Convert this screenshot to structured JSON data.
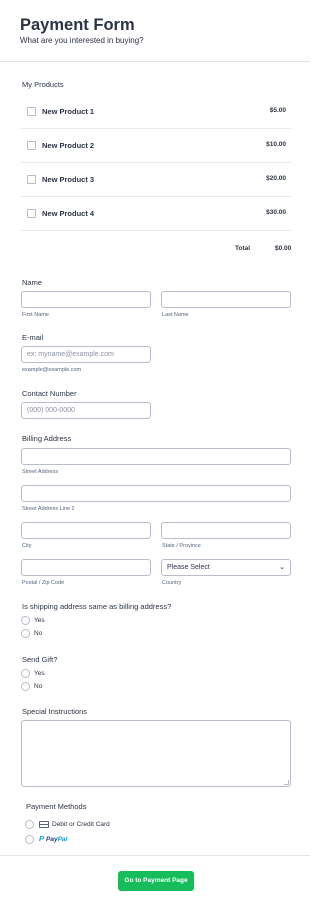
{
  "header": {
    "title": "Payment Form",
    "subtitle": "What are you interested in buying?"
  },
  "products": {
    "label": "My Products",
    "items": [
      {
        "name": "New Product 1",
        "price": "$5.00"
      },
      {
        "name": "New Product 2",
        "price": "$10.00"
      },
      {
        "name": "New Product 3",
        "price": "$20.00"
      },
      {
        "name": "New Product 4",
        "price": "$30.00"
      }
    ],
    "total_label": "Total",
    "total_value": "$0.00"
  },
  "name": {
    "label": "Name",
    "first_sub": "First Name",
    "last_sub": "Last Name"
  },
  "email": {
    "label": "E-mail",
    "placeholder": "ex: myname@example.com",
    "sub": "example@example.com"
  },
  "contact": {
    "label": "Contact Number",
    "placeholder": "(000) 000-0000"
  },
  "billing": {
    "label": "Billing Address",
    "street_sub": "Street Address",
    "street2_sub": "Street Address Line 2",
    "city_sub": "City",
    "state_sub": "State / Province",
    "postal_sub": "Postal / Zip Code",
    "country_sub": "Country",
    "country_value": "Please Select"
  },
  "shipping_same": {
    "label": "Is shipping address same as billing address?",
    "options": [
      "Yes",
      "No"
    ]
  },
  "send_gift": {
    "label": "Send Gift?",
    "options": [
      "Yes",
      "No"
    ]
  },
  "instructions": {
    "label": "Special Instructions"
  },
  "payment": {
    "label": "Payment Methods",
    "card_label": "Debit or Credit Card",
    "paypal_part1": "Pay",
    "paypal_part2": "Pal"
  },
  "submit": {
    "label": "Go to Payment Page"
  }
}
